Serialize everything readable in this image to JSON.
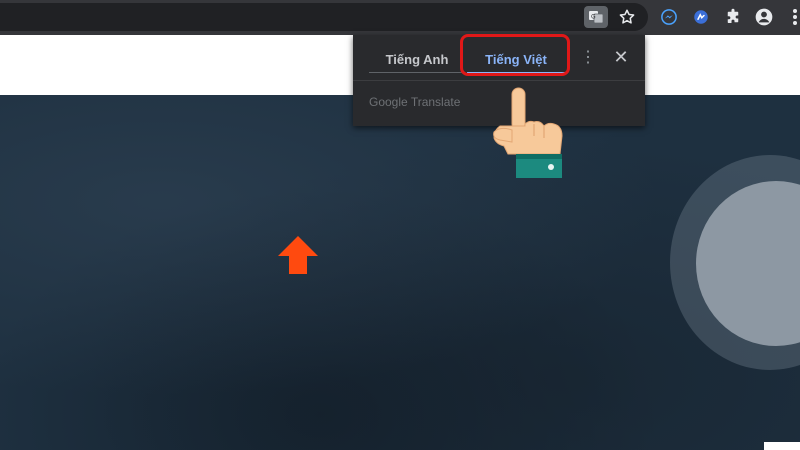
{
  "browser": {
    "toolbar_icons": [
      "translate-icon",
      "star-icon",
      "messenger-icon",
      "extension-blue-icon",
      "puzzle-icon",
      "account-icon",
      "more-icon"
    ]
  },
  "translate_popup": {
    "tab_source": "Tiếng Anh",
    "tab_target": "Tiếng Việt",
    "active_tab": "Tiếng Việt",
    "menu_glyph": "⋮",
    "close_glyph": "✕",
    "powered_by": "Google Translate"
  },
  "annotations": {
    "highlight_color": "#e01818",
    "arrow_color": "#ff4a0f",
    "hand_pointer": "pointing-hand-icon"
  }
}
